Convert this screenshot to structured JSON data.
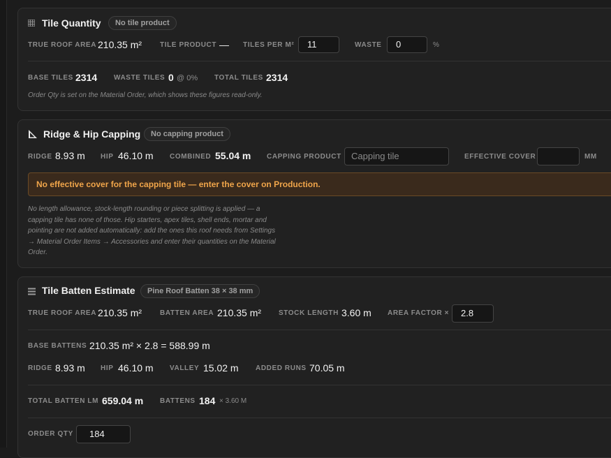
{
  "tile_quantity": {
    "title": "Tile Quantity",
    "badge": "No tile product",
    "icon": "grid-icon",
    "true_roof_area_label": "TRUE ROOF AREA",
    "true_roof_area_value": "210.35 m²",
    "tile_product_label": "TILE PRODUCT",
    "tile_product_value": "—",
    "tiles_per_m2_label": "TILES PER M²",
    "tiles_per_m2_value": "11",
    "waste_label": "WASTE",
    "waste_value": "0",
    "waste_unit": "%",
    "base_tiles_label": "BASE TILES",
    "base_tiles_value": "2314",
    "waste_tiles_label": "WASTE TILES",
    "waste_tiles_value": "0",
    "waste_tiles_sub": "@ 0%",
    "total_tiles_label": "TOTAL TILES",
    "total_tiles_value": "2314",
    "note": "Order Qty is set on the Material Order, which shows these figures read-only."
  },
  "ridge_hip": {
    "title": "Ridge & Hip Capping",
    "badge": "No capping product",
    "icon": "triangle-icon",
    "ridge_label": "RIDGE",
    "ridge_value": "8.93 m",
    "hip_label": "HIP",
    "hip_value": "46.10 m",
    "combined_label": "COMBINED",
    "combined_value": "55.04 m",
    "capping_product_label": "CAPPING PRODUCT",
    "capping_product_placeholder": "Capping tile",
    "effective_cover_label": "EFFECTIVE COVER",
    "effective_cover_value": "",
    "effective_cover_unit": "MM",
    "warning": "No effective cover for the capping tile — enter the cover on Production.",
    "note_lines": [
      "No length allowance, stock-length rounding or piece splitting is applied — a",
      "capping tile has none of those. Hip starters, apex tiles, shell ends, mortar and",
      "pointing are not added automatically: add the ones this roof needs from Settings",
      "→ Material Order Items → Accessories and enter their quantities on the Material",
      "Order."
    ]
  },
  "batten": {
    "title": "Tile Batten Estimate",
    "badge": "Pine Roof Batten 38 × 38 mm",
    "icon": "list-icon",
    "true_roof_area_label": "TRUE ROOF AREA",
    "true_roof_area_value": "210.35 m²",
    "batten_area_label": "BATTEN AREA",
    "batten_area_value": "210.35 m²",
    "stock_length_label": "STOCK LENGTH",
    "stock_length_value": "3.60 m",
    "area_factor_label": "AREA FACTOR ×",
    "area_factor_value": "2.8",
    "base_battens_label": "BASE BATTENS",
    "base_battens_value": "210.35 m² × 2.8 = 588.99 m",
    "ridge_label": "RIDGE",
    "ridge_value": "8.93 m",
    "hip_label": "HIP",
    "hip_value": "46.10 m",
    "valley_label": "VALLEY",
    "valley_value": "15.02 m",
    "added_runs_label": "ADDED RUNS",
    "added_runs_value": "70.05 m",
    "total_lm_label": "TOTAL BATTEN LM",
    "total_lm_value": "659.04 m",
    "battens_label": "BATTENS",
    "battens_value": "184",
    "battens_sub": "× 3.60 M",
    "order_qty_label": "ORDER QTY",
    "order_qty_value": "184"
  }
}
